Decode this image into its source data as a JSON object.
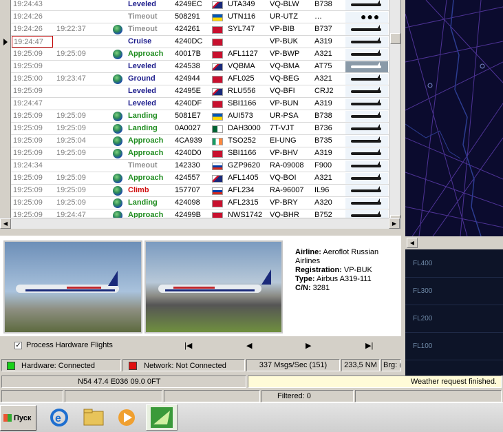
{
  "flights": [
    {
      "t1": "19:24:43",
      "t2": "",
      "globe": false,
      "status": "Leveled",
      "hex": "4249EC",
      "flag": "ru",
      "callsign": "UTA349",
      "reg": "VQ-BLW",
      "type": "B738",
      "pic": "plane"
    },
    {
      "t1": "19:24:26",
      "t2": "",
      "globe": false,
      "status": "Timeout",
      "hex": "508291",
      "flag": "ua",
      "callsign": "UTN116",
      "reg": "UR-UTZ",
      "type": "…",
      "pic": "dots"
    },
    {
      "t1": "19:24:26",
      "t2": "19:22:37",
      "globe": true,
      "status": "Timeout",
      "hex": "424261",
      "flag": "bm",
      "callsign": "SYL747",
      "reg": "VP-BIB",
      "type": "B737",
      "pic": "plane"
    },
    {
      "t1": "19:24:47",
      "t2": "",
      "globe": false,
      "status": "Cruise",
      "hex": "4240DC",
      "flag": "bm",
      "callsign": "",
      "reg": "VP-BUK",
      "type": "A319",
      "pic": "plane",
      "selected": true
    },
    {
      "t1": "19:25:09",
      "t2": "19:25:09",
      "globe": true,
      "status": "Approach",
      "hex": "40017B",
      "flag": "bm",
      "callsign": "AFL1127",
      "reg": "VP-BWP",
      "type": "A321",
      "pic": "plane"
    },
    {
      "t1": "19:25:09",
      "t2": "",
      "globe": false,
      "status": "Leveled",
      "hex": "424538",
      "flag": "ru",
      "callsign": "VQBMA",
      "reg": "VQ-BMA",
      "type": "AT75",
      "pic": "plane-hl"
    },
    {
      "t1": "19:25:00",
      "t2": "19:23:47",
      "globe": true,
      "status": "Ground",
      "hex": "424944",
      "flag": "bm",
      "callsign": "AFL025",
      "reg": "VQ-BEG",
      "type": "A321",
      "pic": "plane"
    },
    {
      "t1": "19:25:09",
      "t2": "",
      "globe": false,
      "status": "Leveled",
      "hex": "42495E",
      "flag": "ru",
      "callsign": "RLU556",
      "reg": "VQ-BFI",
      "type": "CRJ2",
      "pic": "plane"
    },
    {
      "t1": "19:24:47",
      "t2": "",
      "globe": false,
      "status": "Leveled",
      "hex": "4240DF",
      "flag": "bm",
      "callsign": "SBI1166",
      "reg": "VP-BUN",
      "type": "A319",
      "pic": "plane"
    },
    {
      "t1": "19:25:09",
      "t2": "19:25:09",
      "globe": true,
      "status": "Landing",
      "hex": "5081E7",
      "flag": "ua",
      "callsign": "AUI573",
      "reg": "UR-PSA",
      "type": "B738",
      "pic": "plane"
    },
    {
      "t1": "19:25:09",
      "t2": "19:25:09",
      "globe": true,
      "status": "Landing",
      "hex": "0A0027",
      "flag": "dz",
      "callsign": "DAH3000",
      "reg": "7T-VJT",
      "type": "B736",
      "pic": "plane"
    },
    {
      "t1": "19:25:09",
      "t2": "19:25:04",
      "globe": true,
      "status": "Approach",
      "hex": "4CA939",
      "flag": "ie",
      "callsign": "TSO252",
      "reg": "EI-UNG",
      "type": "B735",
      "pic": "plane"
    },
    {
      "t1": "19:25:09",
      "t2": "19:25:09",
      "globe": true,
      "status": "Approach",
      "hex": "4240D0",
      "flag": "bm",
      "callsign": "SBI1166",
      "reg": "VP-BHV",
      "type": "A319",
      "pic": "plane"
    },
    {
      "t1": "19:24:34",
      "t2": "",
      "globe": false,
      "status": "Timeout",
      "hex": "142330",
      "flag": "ru3",
      "callsign": "GZP9620",
      "reg": "RA-09008",
      "type": "F900",
      "pic": "plane"
    },
    {
      "t1": "19:25:09",
      "t2": "19:25:09",
      "globe": true,
      "status": "Approach",
      "hex": "424557",
      "flag": "ru",
      "callsign": "AFL1405",
      "reg": "VQ-BOI",
      "type": "A321",
      "pic": "plane"
    },
    {
      "t1": "19:25:09",
      "t2": "19:25:09",
      "globe": true,
      "status": "Climb",
      "hex": "157707",
      "flag": "ru3",
      "callsign": "AFL234",
      "reg": "RA-96007",
      "type": "IL96",
      "pic": "plane"
    },
    {
      "t1": "19:25:09",
      "t2": "19:25:09",
      "globe": true,
      "status": "Landing",
      "hex": "424098",
      "flag": "bm",
      "callsign": "AFL2315",
      "reg": "VP-BRY",
      "type": "A320",
      "pic": "plane"
    },
    {
      "t1": "19:25:09",
      "t2": "19:24:47",
      "globe": true,
      "status": "Approach",
      "hex": "42499B",
      "flag": "bm",
      "callsign": "NWS1742",
      "reg": "VQ-BHR",
      "type": "B752",
      "pic": "plane"
    }
  ],
  "flag_colors": {
    "ru": [
      "#ffffff",
      "#c8102e"
    ],
    "ua": [
      "#0057b7",
      "#ffd700"
    ],
    "bm": [
      "#c8102e",
      "#c8102e"
    ],
    "dz": [
      "#006233",
      "#ffffff"
    ],
    "ie": [
      "#169b62",
      "#ff883e"
    ],
    "ru3": [
      "#ffffff",
      "#0039a6"
    ]
  },
  "status_colors": {
    "Leveled": "#1c1c8c",
    "Timeout": "#909090",
    "Cruise": "#1c1c8c",
    "Approach": "#1e8c1e",
    "Ground": "#1c1c8c",
    "Landing": "#1e8c1e",
    "Climb": "#d01010"
  },
  "details": {
    "airline_label": "Airline:",
    "airline": "Aeroflot Russian Airlines",
    "registration_label": "Registration:",
    "registration": "VP-BUK",
    "type_label": "Type:",
    "type": "Airbus A319-111",
    "cn_label": "C/N:",
    "cn": "3281"
  },
  "controls": {
    "process_hardware": "Process Hardware Flights",
    "first": "|◀",
    "prev": "◀",
    "next": "▶",
    "last": "▶|"
  },
  "status": {
    "hardware": "Hardware: Connected",
    "hardware_color": "#19d119",
    "network": "Network: Not Connected",
    "network_color": "#e01010",
    "rate": "337 Msgs/Sec (151)",
    "range": "233,5 NM",
    "brg": "Brg: (",
    "position": "N54 47.4 E036 09.0   0FT",
    "weather": "Weather request finished.",
    "filtered": "Filtered: 0"
  },
  "altitude_labels": [
    "FL400",
    "FL300",
    "FL200",
    "FL100"
  ],
  "taskbar": {
    "start": "Пуск",
    "apps": [
      "internet-explorer-icon",
      "file-explorer-icon",
      "media-player-icon",
      "radarbox-icon"
    ]
  }
}
